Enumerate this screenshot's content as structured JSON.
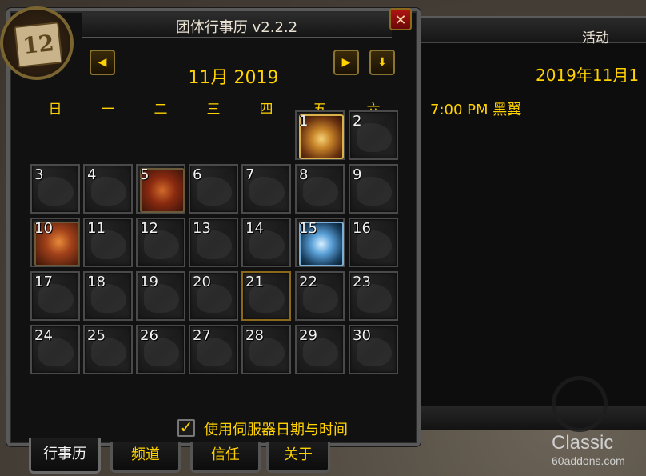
{
  "window": {
    "title": "团体行事历 v2.2.2",
    "close_label": "✕",
    "portrait_number": "12"
  },
  "nav": {
    "prev_icon": "◀",
    "next_icon": "▶",
    "today_icon": "⬇",
    "month_label": "11月 2019"
  },
  "weekdays": [
    "日",
    "一",
    "二",
    "三",
    "四",
    "五",
    "六"
  ],
  "days": [
    "1",
    "2",
    "3",
    "4",
    "5",
    "6",
    "7",
    "8",
    "9",
    "10",
    "11",
    "12",
    "13",
    "14",
    "15",
    "16",
    "17",
    "18",
    "19",
    "20",
    "21",
    "22",
    "23",
    "24",
    "25",
    "26",
    "27",
    "28",
    "29",
    "30"
  ],
  "today": "21",
  "events": [
    {
      "day": "1",
      "icon": "ragnaros-icon"
    },
    {
      "day": "5",
      "icon": "onyxia-icon"
    },
    {
      "day": "10",
      "icon": "onyxia-icon"
    },
    {
      "day": "15",
      "icon": "naxxramas-icon"
    }
  ],
  "server_time": {
    "checked": true,
    "label": "使用伺服器日期与时间"
  },
  "tabs": [
    "行事历",
    "频道",
    "信任",
    "关于"
  ],
  "side_panel": {
    "title": "活动",
    "date": "2019年11月1",
    "event": "7:00 PM  黑翼"
  },
  "watermark": {
    "brand": "Classic",
    "site": "60addons.com"
  },
  "colors": {
    "gold_text": "#ffd200",
    "frame_border": "#595959",
    "close_red": "#b01414"
  }
}
